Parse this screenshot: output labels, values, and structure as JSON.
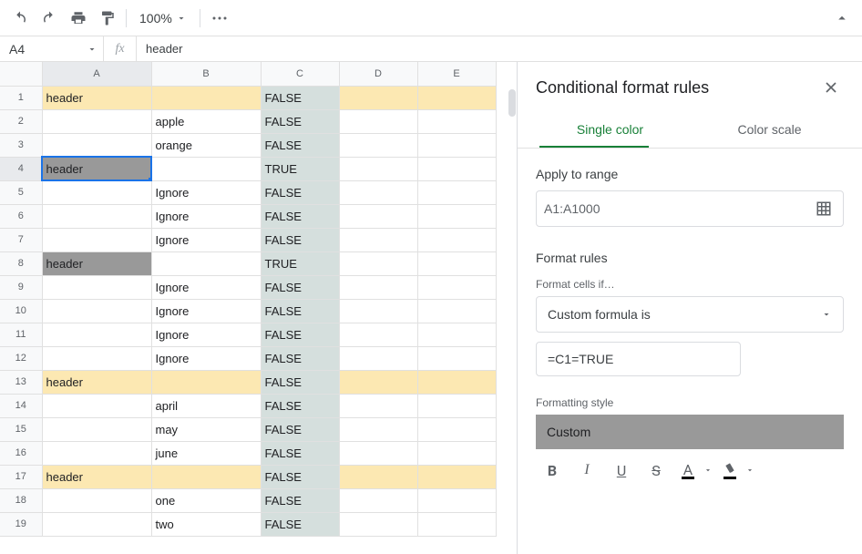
{
  "toolbar": {
    "zoom_label": "100%"
  },
  "namebox": {
    "ref": "A4",
    "formula_value": "header"
  },
  "columns": [
    "A",
    "B",
    "C",
    "D",
    "E"
  ],
  "rows": [
    {
      "n": 1,
      "a": "header",
      "b": "",
      "c": "FALSE",
      "a_cls": "hl-yellow",
      "row_cls": "hl-yellow"
    },
    {
      "n": 2,
      "a": "",
      "b": "apple",
      "c": "FALSE"
    },
    {
      "n": 3,
      "a": "",
      "b": "orange",
      "c": "FALSE"
    },
    {
      "n": 4,
      "a": "header",
      "b": "",
      "c": "TRUE",
      "a_cls": "hl-grey",
      "row_cls": "",
      "selected": true
    },
    {
      "n": 5,
      "a": "",
      "b": "Ignore",
      "c": "FALSE"
    },
    {
      "n": 6,
      "a": "",
      "b": "Ignore",
      "c": "FALSE"
    },
    {
      "n": 7,
      "a": "",
      "b": "Ignore",
      "c": "FALSE"
    },
    {
      "n": 8,
      "a": "header",
      "b": "",
      "c": "TRUE",
      "a_cls": "hl-grey"
    },
    {
      "n": 9,
      "a": "",
      "b": "Ignore",
      "c": "FALSE"
    },
    {
      "n": 10,
      "a": "",
      "b": "Ignore",
      "c": "FALSE"
    },
    {
      "n": 11,
      "a": "",
      "b": "Ignore",
      "c": "FALSE"
    },
    {
      "n": 12,
      "a": "",
      "b": "Ignore",
      "c": "FALSE"
    },
    {
      "n": 13,
      "a": "header",
      "b": "",
      "c": "FALSE",
      "a_cls": "hl-yellow",
      "row_cls": "hl-yellow"
    },
    {
      "n": 14,
      "a": "",
      "b": "april",
      "c": "FALSE"
    },
    {
      "n": 15,
      "a": "",
      "b": "may",
      "c": "FALSE"
    },
    {
      "n": 16,
      "a": "",
      "b": "june",
      "c": "FALSE"
    },
    {
      "n": 17,
      "a": "header",
      "b": "",
      "c": "FALSE",
      "a_cls": "hl-yellow",
      "row_cls": "hl-yellow"
    },
    {
      "n": 18,
      "a": "",
      "b": "one",
      "c": "FALSE"
    },
    {
      "n": 19,
      "a": "",
      "b": "two",
      "c": "FALSE"
    }
  ],
  "sidebar": {
    "title": "Conditional format rules",
    "tabs": {
      "single": "Single color",
      "scale": "Color scale"
    },
    "apply_to_range_label": "Apply to range",
    "range_value": "A1:A1000",
    "format_rules_label": "Format rules",
    "format_if_label": "Format cells if…",
    "rule_type": "Custom formula is",
    "formula_value": "=C1=TRUE",
    "style_label": "Formatting style",
    "style_value": "Custom",
    "fmt": {
      "bold": "B",
      "italic": "I",
      "underline": "U",
      "strike": "S",
      "textcolor": "A"
    }
  }
}
